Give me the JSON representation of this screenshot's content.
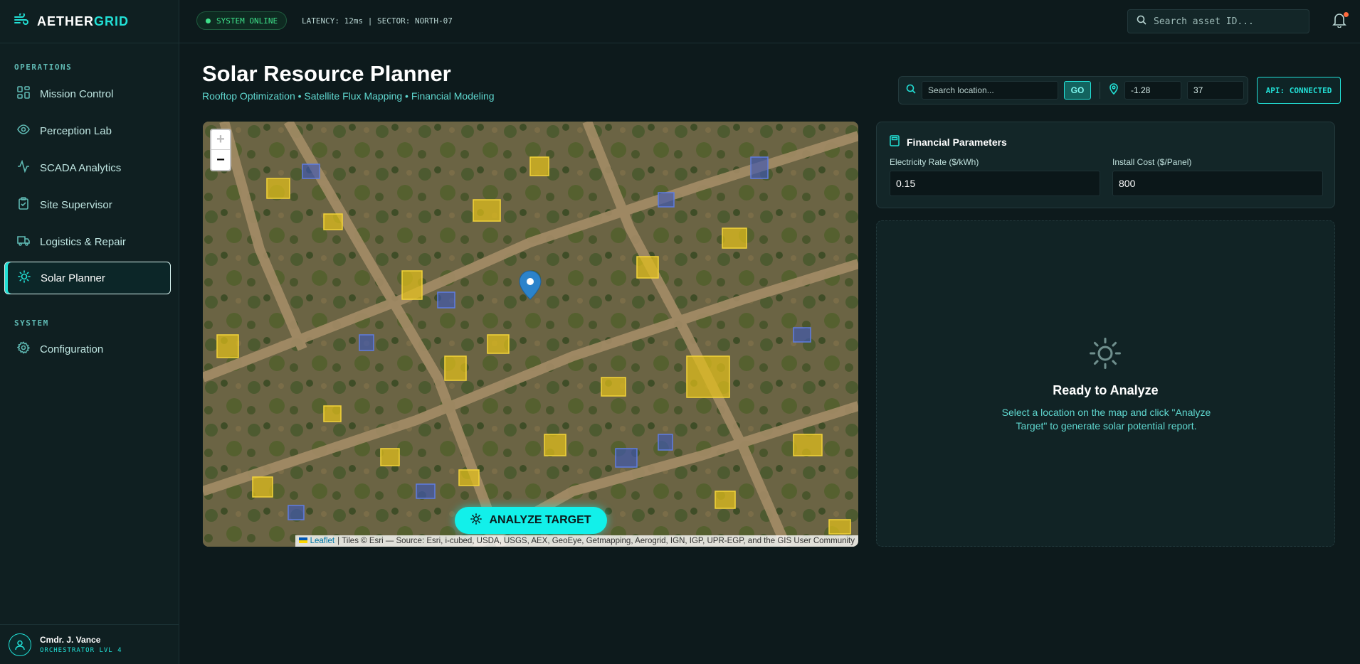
{
  "brand": {
    "name_main": "AETHER",
    "name_accent": "GRID"
  },
  "topbar": {
    "status": "SYSTEM ONLINE",
    "latency": "LATENCY: 12ms | SECTOR: NORTH-07",
    "search_placeholder": "Search asset ID..."
  },
  "sidebar": {
    "section_operations": "OPERATIONS",
    "section_system": "SYSTEM",
    "items": [
      {
        "label": "Mission Control",
        "icon": "dashboard-icon"
      },
      {
        "label": "Perception Lab",
        "icon": "eye-icon"
      },
      {
        "label": "SCADA Analytics",
        "icon": "activity-icon"
      },
      {
        "label": "Site Supervisor",
        "icon": "clipboard-check-icon"
      },
      {
        "label": "Logistics & Repair",
        "icon": "truck-icon"
      },
      {
        "label": "Solar Planner",
        "icon": "sun-icon",
        "active": true
      }
    ],
    "system_items": [
      {
        "label": "Configuration",
        "icon": "gear-icon"
      }
    ],
    "user": {
      "name": "Cmdr. J. Vance",
      "role": "ORCHESTRATOR LVL 4"
    }
  },
  "header": {
    "title": "Solar Resource Planner",
    "subtitle": "Rooftop Optimization • Satellite Flux Mapping • Financial Modeling"
  },
  "location": {
    "placeholder": "Search location...",
    "go_label": "GO",
    "lat": "-1.28",
    "lng": "37",
    "api_status": "API: CONNECTED"
  },
  "map": {
    "zoom_in": "+",
    "zoom_out": "−",
    "analyze_label": "ANALYZE TARGET",
    "attribution_link": "Leaflet",
    "attribution_text": "| Tiles © Esri — Source: Esri, i-cubed, USDA, USGS, AEX, GeoEye, Getmapping, Aerogrid, IGN, IGP, UPR-EGP, and the GIS User Community"
  },
  "financial": {
    "title": "Financial Parameters",
    "rate_label": "Electricity Rate ($/kWh)",
    "rate_value": "0.15",
    "cost_label": "Install Cost ($/Panel)",
    "cost_value": "800"
  },
  "ready": {
    "title": "Ready to Analyze",
    "description": "Select a location on the map and click \"Analyze Target\" to generate solar potential report."
  },
  "colors": {
    "accent": "#22e0d6",
    "status_green": "#3ee08a",
    "background": "#0d1a1c"
  }
}
